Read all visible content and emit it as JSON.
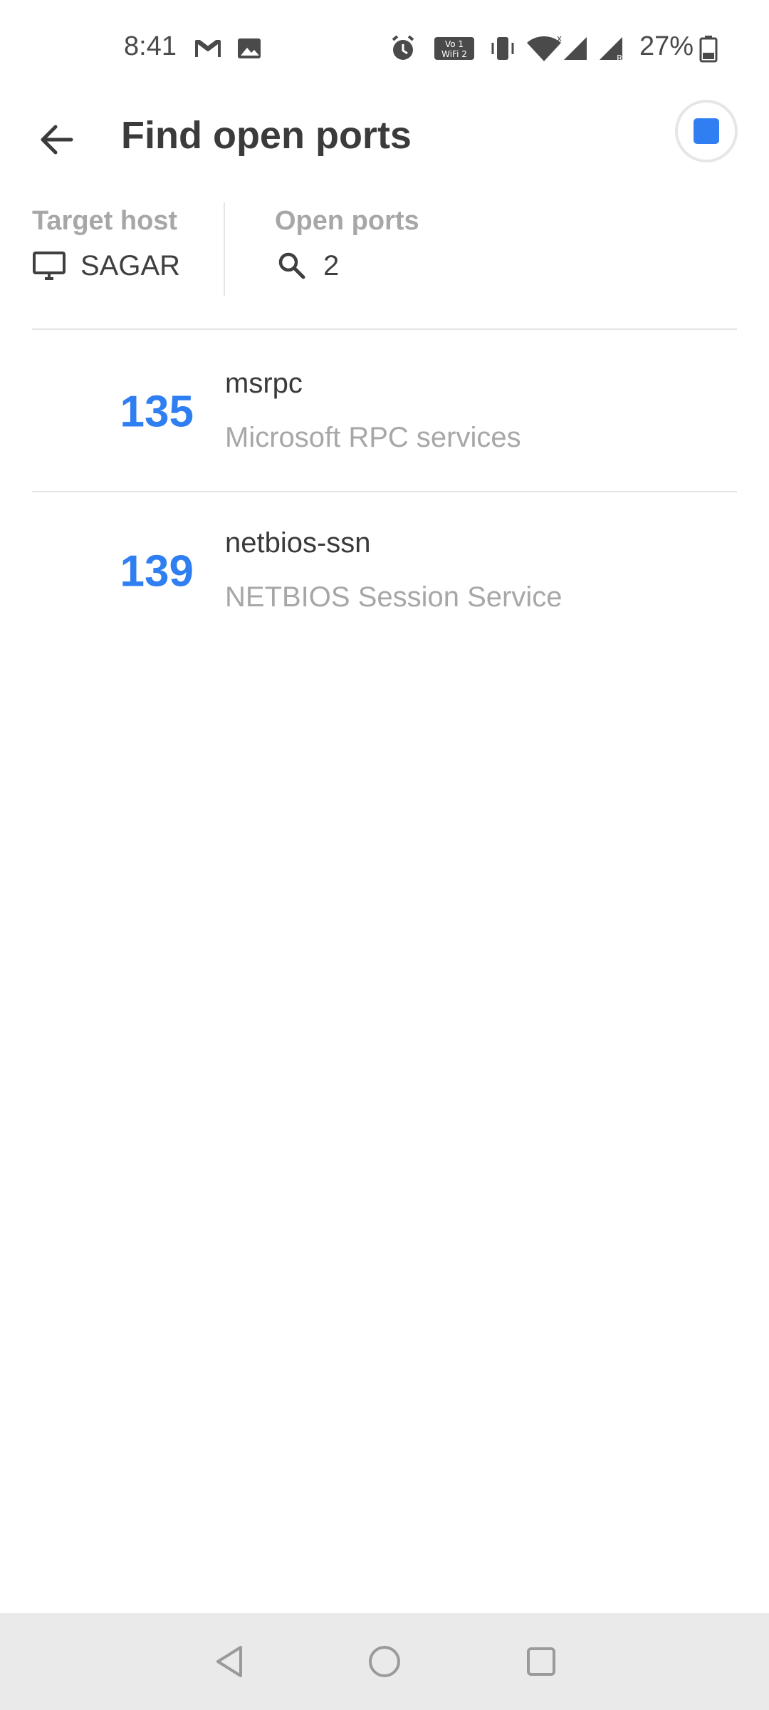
{
  "status_bar": {
    "time": "8:41",
    "battery_percent": "27%",
    "icons": [
      "gmail-icon",
      "gallery-icon",
      "alarm-icon",
      "vowifi-icon",
      "vibrate-icon",
      "wifi-icon",
      "signal-icon",
      "signal-roaming-icon",
      "battery-icon"
    ]
  },
  "app_bar": {
    "title": "Find open ports",
    "back_icon": "arrow-left-icon",
    "stop_icon": "stop-icon",
    "accent_color": "#2f7ff2"
  },
  "info": {
    "target_host_label": "Target host",
    "target_host_value": "SAGAR",
    "open_ports_label": "Open ports",
    "open_ports_value": "2"
  },
  "ports": [
    {
      "port": "135",
      "service": "msrpc",
      "description": "Microsoft RPC services"
    },
    {
      "port": "139",
      "service": "netbios-ssn",
      "description": "NETBIOS Session Service"
    }
  ],
  "nav_bar": {
    "buttons": [
      "back-triangle-icon",
      "home-circle-icon",
      "recents-square-icon"
    ]
  }
}
